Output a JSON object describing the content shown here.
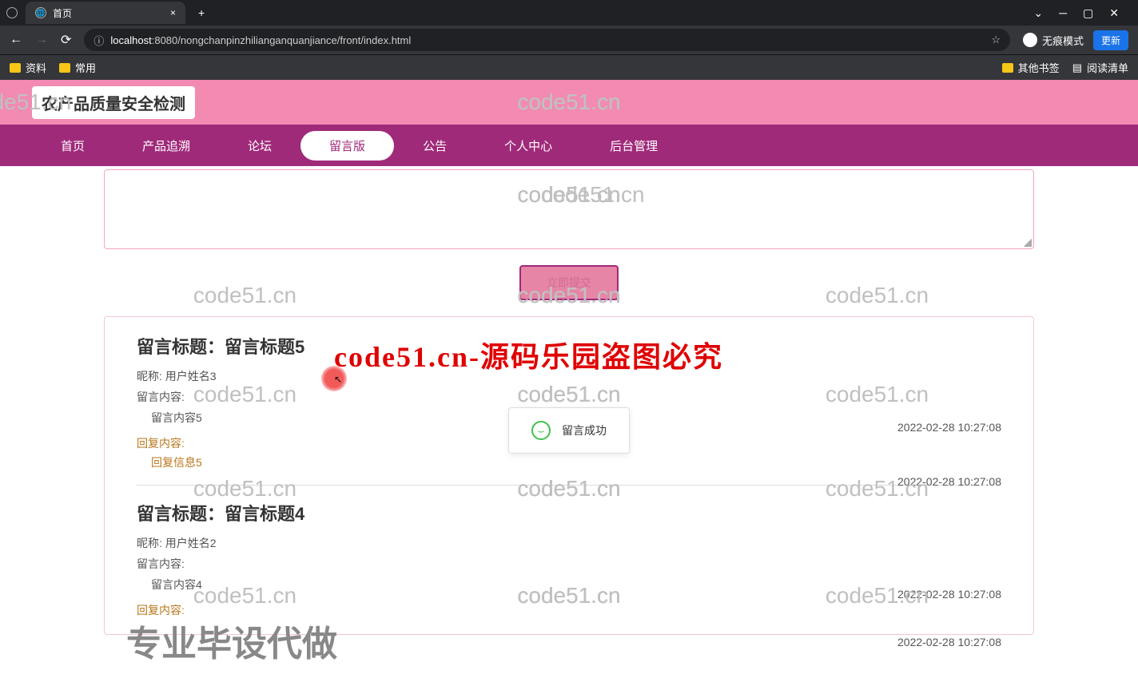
{
  "browser": {
    "tab_title": "首页",
    "url_host": "localhost",
    "url_path": ":8080/nongchanpinzhilianganquanjiance/front/index.html",
    "incognito_label": "无痕模式",
    "update_label": "更新",
    "bookmarks": [
      "资料",
      "常用"
    ],
    "bm_right": [
      "其他书签",
      "阅读清单"
    ]
  },
  "page": {
    "title": "农产品质量安全检测",
    "nav": [
      "首页",
      "产品追溯",
      "论坛",
      "留言版",
      "公告",
      "个人中心",
      "后台管理"
    ],
    "active_nav": 3,
    "submit_label": "立即提交",
    "toast": "留言成功",
    "messages": [
      {
        "title_label": "留言标题：",
        "title": "留言标题5",
        "nick_label": "昵称:",
        "nick": "用户姓名3",
        "content_label": "留言内容:",
        "content": "留言内容5",
        "time1": "2022-02-28 10:27:08",
        "reply_label": "回复内容:",
        "reply": "回复信息5",
        "time2": "2022-02-28 10:27:08"
      },
      {
        "title_label": "留言标题：",
        "title": "留言标题4",
        "nick_label": "昵称:",
        "nick": "用户姓名2",
        "content_label": "留言内容:",
        "content": "留言内容4",
        "time1": "2022-02-28 10:27:08",
        "reply_label": "回复内容:",
        "reply": "",
        "time2": "2022-02-28 10:27:08"
      }
    ]
  },
  "watermark": {
    "text": "code51.cn",
    "big1": "code51.cn-源码乐园盗图必究",
    "big2": "专业毕设代做"
  }
}
